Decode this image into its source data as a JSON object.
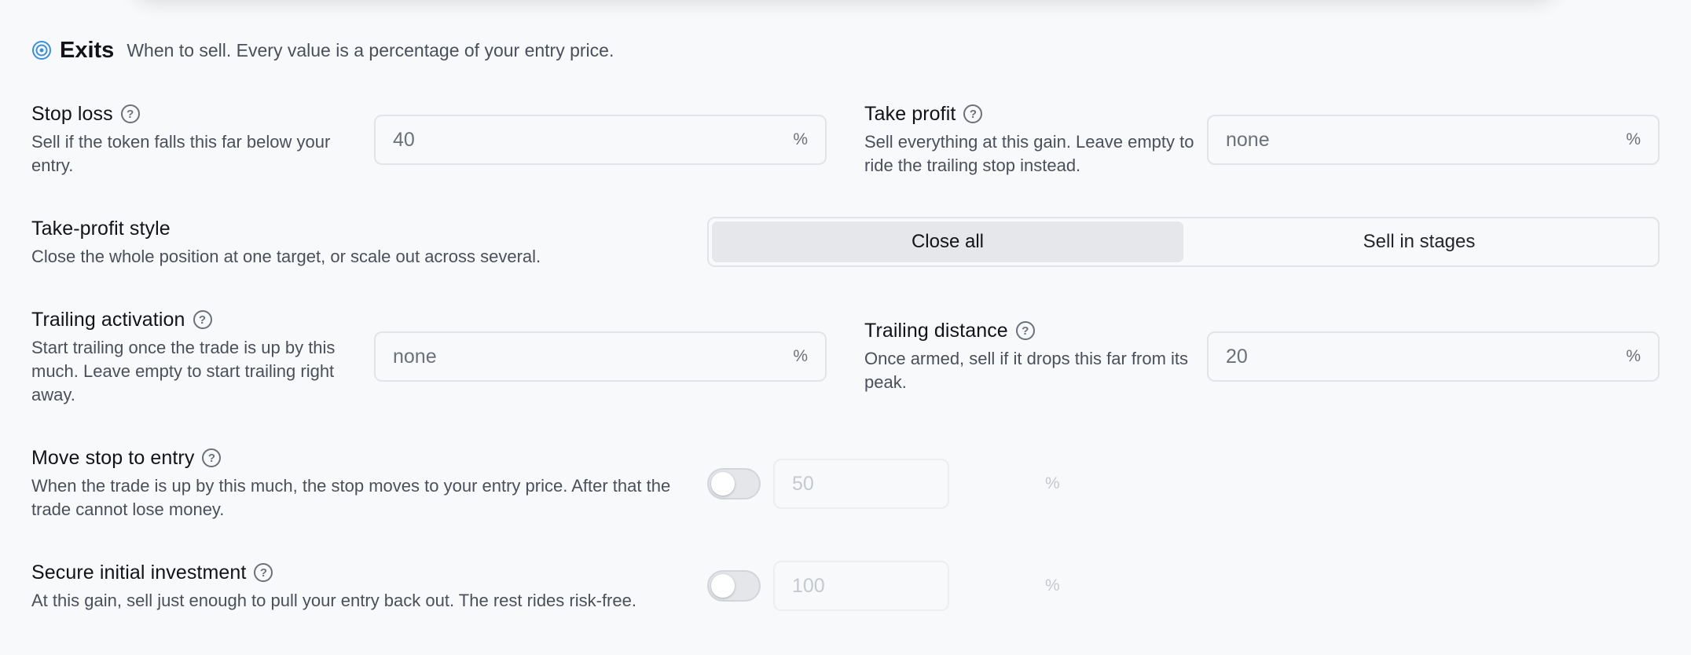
{
  "section": {
    "icon": "target-icon",
    "title": "Exits",
    "description": "When to sell. Every value is a percentage of your entry price."
  },
  "help_glyph": "?",
  "fields": {
    "stop_loss": {
      "label": "Stop loss",
      "description": "Sell if the token falls this far below your entry.",
      "placeholder": "40",
      "unit": "%"
    },
    "take_profit": {
      "label": "Take profit",
      "description": "Sell everything at this gain. Leave empty to ride the trailing stop instead.",
      "placeholder": "none",
      "unit": "%"
    },
    "take_profit_style": {
      "label": "Take-profit style",
      "description": "Close the whole position at one target, or scale out across several.",
      "options": [
        "Close all",
        "Sell in stages"
      ],
      "selected": "Close all"
    },
    "trailing_activation": {
      "label": "Trailing activation",
      "description": "Start trailing once the trade is up by this much. Leave empty to start trailing right away.",
      "placeholder": "none",
      "unit": "%"
    },
    "trailing_distance": {
      "label": "Trailing distance",
      "description": "Once armed, sell if it drops this far from its peak.",
      "placeholder": "20",
      "unit": "%"
    },
    "move_stop_to_entry": {
      "label": "Move stop to entry",
      "description": "When the trade is up by this much, the stop moves to your entry price. After that the trade cannot lose money.",
      "enabled": false,
      "placeholder": "50",
      "unit": "%"
    },
    "secure_initial_investment": {
      "label": "Secure initial investment",
      "description": "At this gain, sell just enough to pull your entry back out. The rest rides risk-free.",
      "enabled": false,
      "placeholder": "100",
      "unit": "%"
    }
  },
  "colors": {
    "background": "#f8f9fb",
    "accent_icon": "#3b8fd9",
    "border": "#e1e4e9",
    "active_segment": "#e6e7eb"
  }
}
